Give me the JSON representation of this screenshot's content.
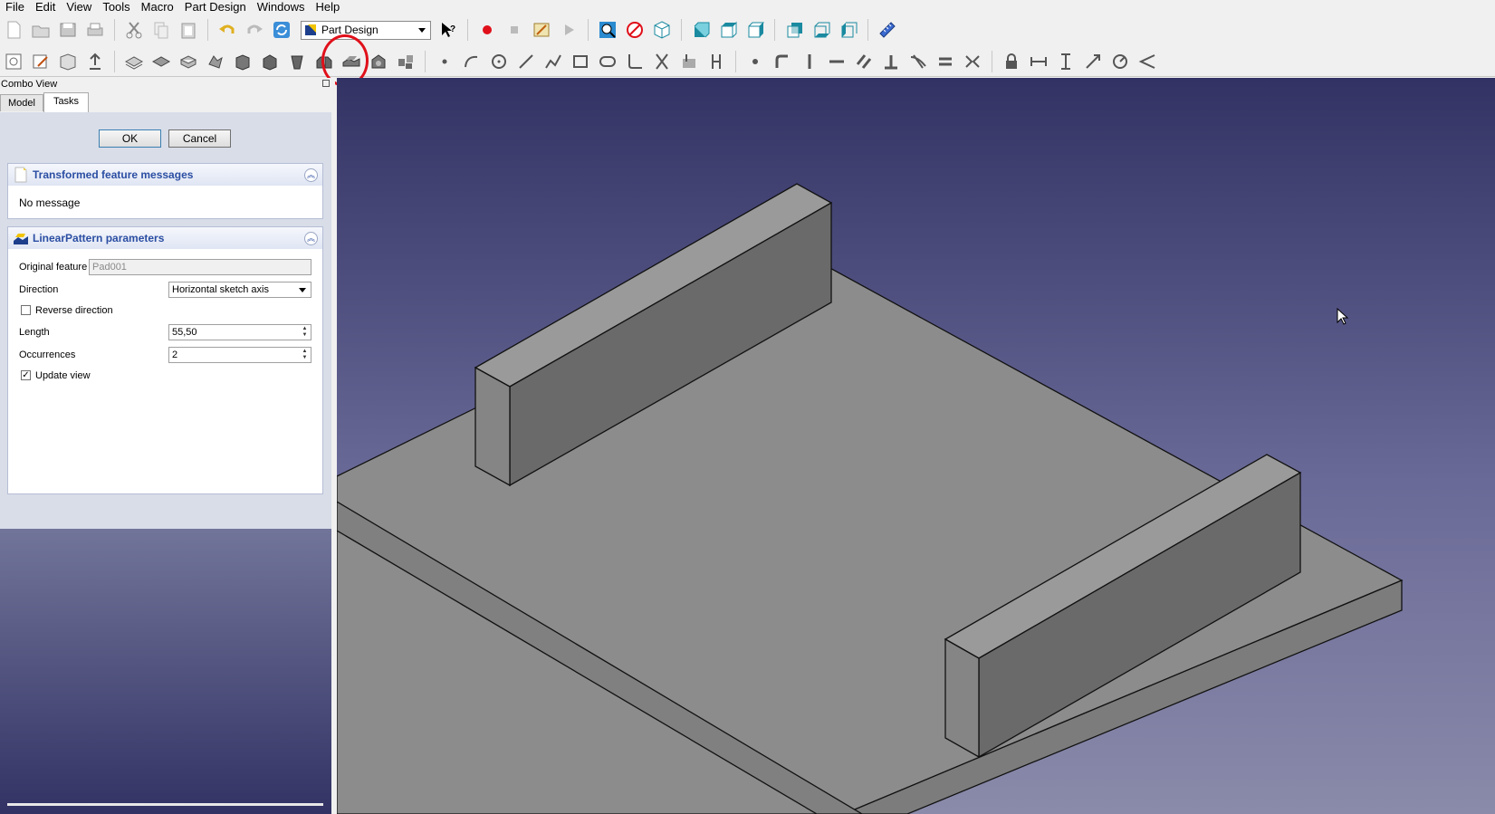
{
  "menu": [
    "File",
    "Edit",
    "View",
    "Tools",
    "Macro",
    "Part Design",
    "Windows",
    "Help"
  ],
  "toolbar": {
    "workbench": "Part Design",
    "record_color": "#e0101a"
  },
  "combo": {
    "title": "Combo View",
    "tabs": [
      "Model",
      "Tasks"
    ],
    "active_tab": "Tasks"
  },
  "task": {
    "ok": "OK",
    "cancel": "Cancel",
    "messages": {
      "title": "Transformed feature messages",
      "text": "No message"
    },
    "params": {
      "title": "LinearPattern parameters",
      "original_feature_label": "Original feature",
      "original_feature_value": "Pad001",
      "direction_label": "Direction",
      "direction_value": "Horizontal sketch axis",
      "reverse_label": "Reverse direction",
      "reverse_checked": false,
      "length_label": "Length",
      "length_value": "55,50",
      "occurrences_label": "Occurrences",
      "occurrences_value": "2",
      "update_label": "Update view",
      "update_checked": true
    }
  },
  "viewport": {
    "face_top": "#8c8c8c",
    "face_front": "#7a7a7a",
    "face_side": "#6b6b6b",
    "annotation_color": "#e0101a"
  }
}
